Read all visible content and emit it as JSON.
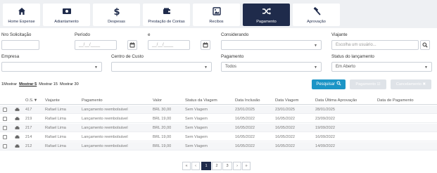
{
  "nav": {
    "tabs": [
      {
        "label": "Home Expense",
        "icon": "home-icon"
      },
      {
        "label": "Adiantamento",
        "icon": "money-icon"
      },
      {
        "label": "Despesas",
        "icon": "dollar-icon"
      },
      {
        "label": "Prestação de Contas",
        "icon": "wallet-icon"
      },
      {
        "label": "Recibos",
        "icon": "image-icon"
      },
      {
        "label": "Pagamento",
        "icon": "shuffle-icon",
        "active": true
      },
      {
        "label": "Aprovação",
        "icon": "gavel-icon"
      }
    ]
  },
  "filters": {
    "nro_label": "Nro Solicitação",
    "periodo_label": "Período",
    "e_label": "e",
    "date_placeholder": "__/__/____",
    "considerando_label": "Considerando",
    "viajante_label": "Viajante",
    "viajante_placeholder": "Escolha um usuário...",
    "empresa_label": "Empresa",
    "centro_label": "Centro de Custo",
    "pagamento_label": "Pagamento",
    "pagamento_value": "Todos",
    "status_label": "Status do lançamento",
    "status_value": "Em Aberto"
  },
  "page_length": {
    "prefix": "1Mostrar",
    "options": [
      "Mostrar 5",
      "Mostrar 15",
      "Mostrar 30"
    ],
    "selected_index": 0
  },
  "actions": {
    "search": "Pesquisar",
    "pagamento": "Pagamento",
    "cancelamento": "Cancelamento"
  },
  "table": {
    "headers": [
      "O.S.▼",
      "Viajante",
      "Pagamento",
      "Valor",
      "Status da Viagem",
      "Data Inclusão",
      "Data Viagem",
      "Data Última Aprovação",
      "Data de Pagamento"
    ],
    "rows": [
      [
        "417",
        "Rafael Lima",
        "Lançamento reembolsável",
        "BRL 30,00",
        "Sem Viagem",
        "23/01/2025",
        "23/01/2025",
        "28/01/2025",
        ""
      ],
      [
        "219",
        "Rafael Lima",
        "Lançamento reembolsável",
        "BRL 19,00",
        "Sem Viagem",
        "16/05/2022",
        "16/05/2022",
        "23/09/2022",
        ""
      ],
      [
        "217",
        "Rafael Lima",
        "Lançamento reembolsável",
        "BRL 20,00",
        "Sem Viagem",
        "16/05/2022",
        "16/05/2022",
        "19/09/2022",
        ""
      ],
      [
        "214",
        "Rafael Lima",
        "Lançamento reembolsável",
        "BRL 19,00",
        "Sem Viagem",
        "16/05/2022",
        "16/05/2022",
        "16/09/2022",
        ""
      ],
      [
        "212",
        "Rafael Lima",
        "Lançamento reembolsável",
        "BRL 19,00",
        "Sem Viagem",
        "16/05/2022",
        "16/05/2022",
        "14/09/2022",
        ""
      ]
    ]
  },
  "pagination": {
    "first": "«",
    "prev": "‹",
    "pages": [
      "1",
      "2",
      "3"
    ],
    "current": "1",
    "next": "›",
    "last": "»"
  },
  "colors": {
    "nav_active": "#1f2b4b",
    "primary_button": "#1c95c6"
  }
}
